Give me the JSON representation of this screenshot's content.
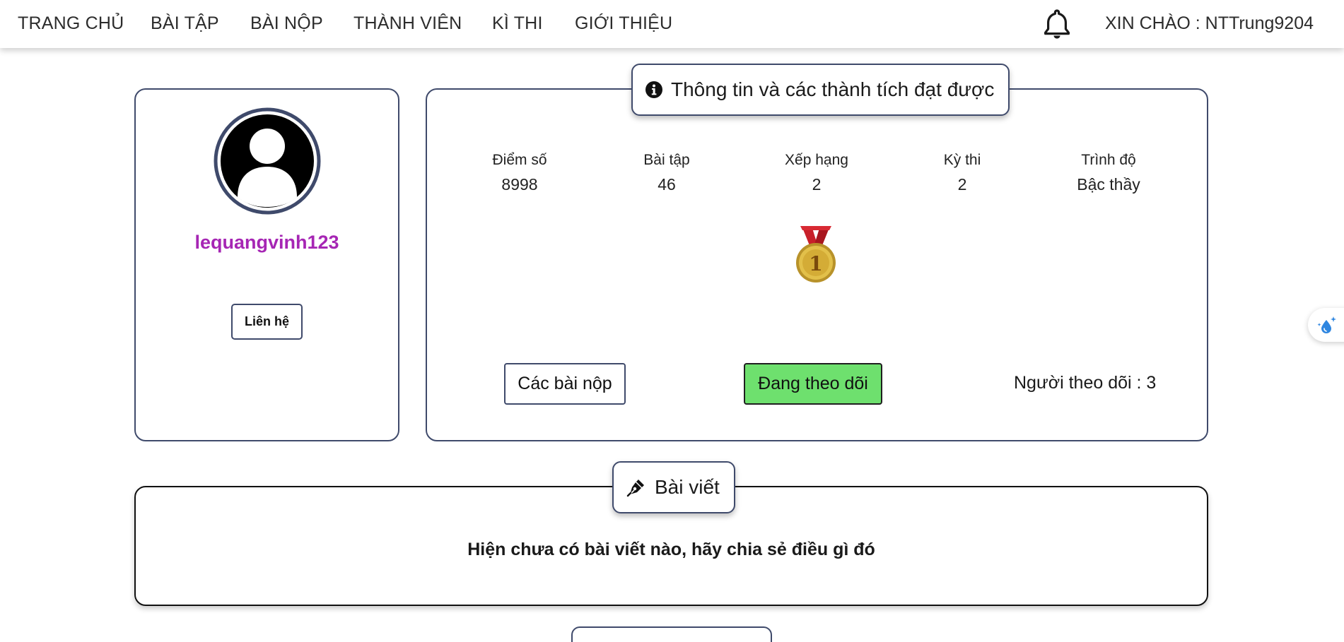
{
  "nav": {
    "items": [
      {
        "label": "TRANG CHỦ"
      },
      {
        "label": "BÀI TẬP"
      },
      {
        "label": "BÀI NỘP"
      },
      {
        "label": "THÀNH VIÊN"
      },
      {
        "label": "KÌ THI"
      },
      {
        "label": "GIỚI THIỆU"
      }
    ],
    "greeting": "XIN CHÀO : NTTrung9204"
  },
  "profile": {
    "username": "lequangvinh123",
    "contact_label": "Liên hệ"
  },
  "info": {
    "title": "Thông tin và các thành tích đạt được",
    "stats": [
      {
        "label": "Điểm số",
        "value": "8998"
      },
      {
        "label": "Bài tập",
        "value": "46"
      },
      {
        "label": "Xếp hạng",
        "value": "2"
      },
      {
        "label": "Kỳ thi",
        "value": "2"
      },
      {
        "label": "Trình độ",
        "value": "Bậc thầy"
      }
    ],
    "medal_number": "1",
    "submissions_label": "Các bài nộp",
    "following_label": "Đang theo dõi",
    "followers_text": "Người theo dõi : 3"
  },
  "posts": {
    "title": "Bài viết",
    "empty_message": "Hiện chưa có bài viết nào, hãy chia sẻ điều gì đó"
  },
  "colors": {
    "accent_border": "#3f4a6b",
    "username": "#a626b4",
    "follow_button": "#6ee06e",
    "medal_gold": "#d9b640",
    "medal_ribbon": "#c8202a"
  }
}
